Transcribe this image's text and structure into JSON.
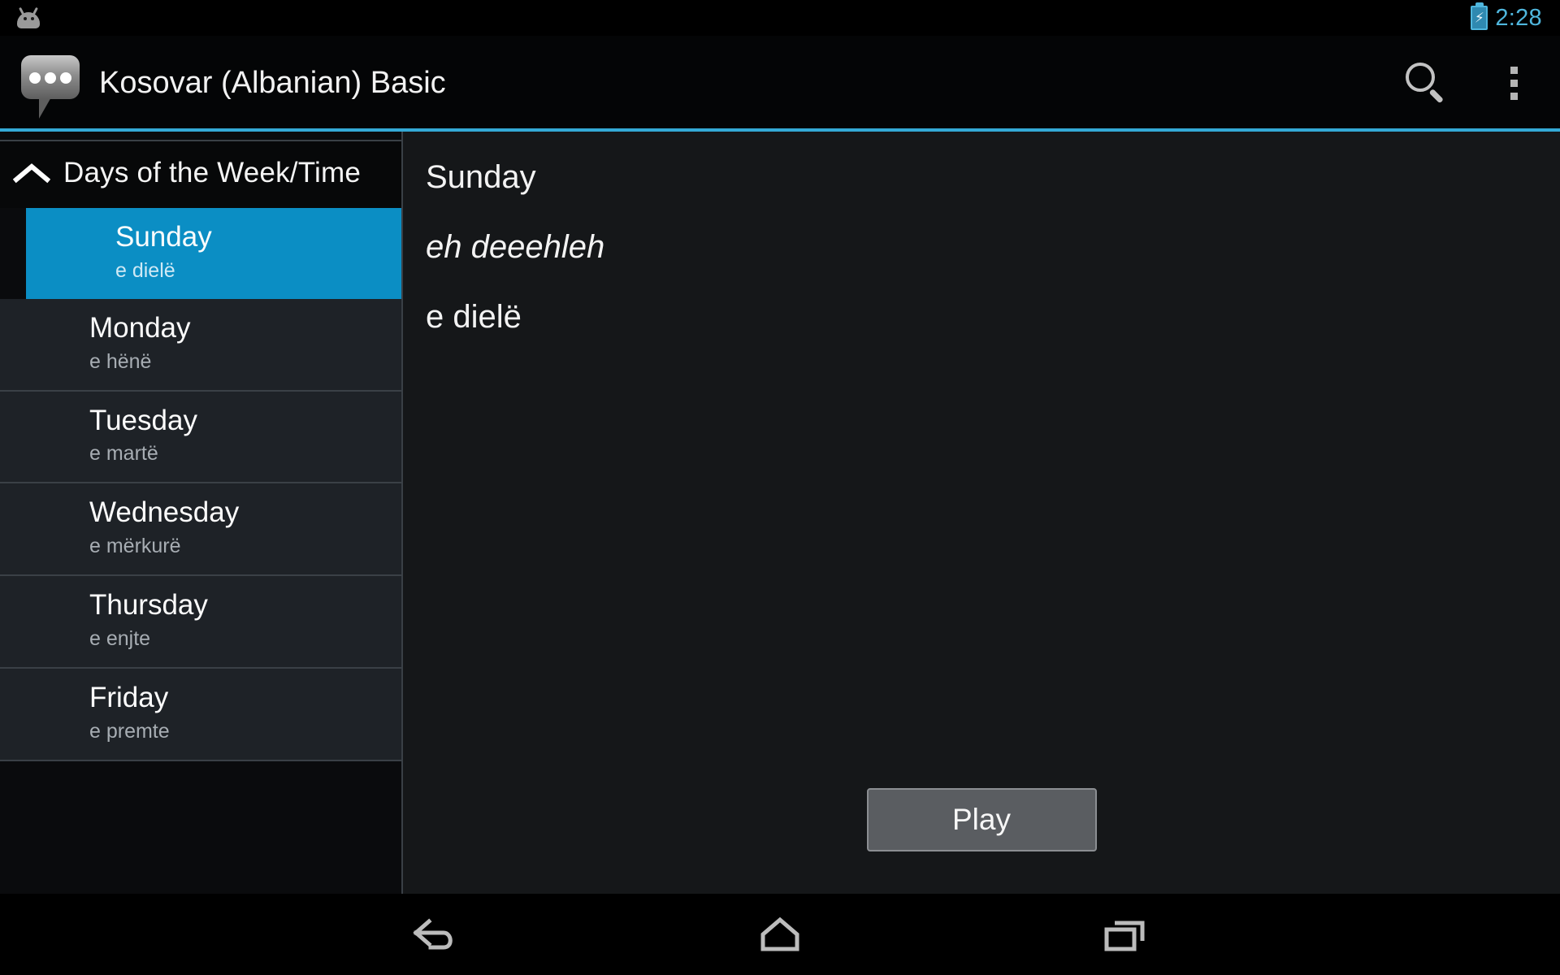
{
  "statusbar": {
    "robot_icon": "android-robot-icon",
    "battery_icon": "battery-charging-icon",
    "time": "2:28"
  },
  "actionbar": {
    "app_icon": "speech-bubble-icon",
    "title": "Kosovar (Albanian) Basic",
    "search_icon": "search-icon",
    "overflow_icon": "overflow-menu-icon",
    "accent_color": "#34a9d6"
  },
  "sidebar": {
    "group": {
      "title": "Days of the Week/Time",
      "collapse_icon": "chevron-up-icon",
      "expanded": true
    },
    "items": [
      {
        "title": "Sunday",
        "sub": "e dielë",
        "selected": true
      },
      {
        "title": "Monday",
        "sub": "e hënë",
        "selected": false
      },
      {
        "title": "Tuesday",
        "sub": "e martë",
        "selected": false
      },
      {
        "title": "Wednesday",
        "sub": "e mërkurë",
        "selected": false
      },
      {
        "title": "Thursday",
        "sub": "e enjte",
        "selected": false
      },
      {
        "title": "Friday",
        "sub": "e premte",
        "selected": false
      }
    ],
    "selected_color": "#0b8ec4"
  },
  "main": {
    "word": "Sunday",
    "pronunciation": "eh deeehleh",
    "translation": "e dielë",
    "play_label": "Play"
  },
  "navbar": {
    "back_icon": "back-arrow-icon",
    "home_icon": "home-icon",
    "recents_icon": "recent-apps-icon"
  }
}
